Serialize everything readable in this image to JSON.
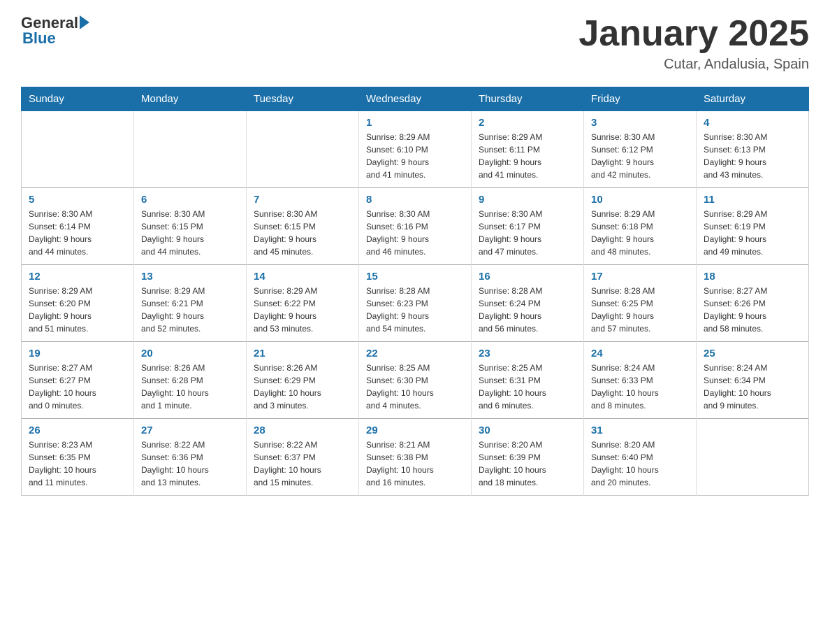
{
  "header": {
    "logo_general": "General",
    "logo_blue": "Blue",
    "title": "January 2025",
    "subtitle": "Cutar, Andalusia, Spain"
  },
  "weekdays": [
    "Sunday",
    "Monday",
    "Tuesday",
    "Wednesday",
    "Thursday",
    "Friday",
    "Saturday"
  ],
  "weeks": [
    [
      {
        "day": "",
        "info": ""
      },
      {
        "day": "",
        "info": ""
      },
      {
        "day": "",
        "info": ""
      },
      {
        "day": "1",
        "info": "Sunrise: 8:29 AM\nSunset: 6:10 PM\nDaylight: 9 hours\nand 41 minutes."
      },
      {
        "day": "2",
        "info": "Sunrise: 8:29 AM\nSunset: 6:11 PM\nDaylight: 9 hours\nand 41 minutes."
      },
      {
        "day": "3",
        "info": "Sunrise: 8:30 AM\nSunset: 6:12 PM\nDaylight: 9 hours\nand 42 minutes."
      },
      {
        "day": "4",
        "info": "Sunrise: 8:30 AM\nSunset: 6:13 PM\nDaylight: 9 hours\nand 43 minutes."
      }
    ],
    [
      {
        "day": "5",
        "info": "Sunrise: 8:30 AM\nSunset: 6:14 PM\nDaylight: 9 hours\nand 44 minutes."
      },
      {
        "day": "6",
        "info": "Sunrise: 8:30 AM\nSunset: 6:15 PM\nDaylight: 9 hours\nand 44 minutes."
      },
      {
        "day": "7",
        "info": "Sunrise: 8:30 AM\nSunset: 6:15 PM\nDaylight: 9 hours\nand 45 minutes."
      },
      {
        "day": "8",
        "info": "Sunrise: 8:30 AM\nSunset: 6:16 PM\nDaylight: 9 hours\nand 46 minutes."
      },
      {
        "day": "9",
        "info": "Sunrise: 8:30 AM\nSunset: 6:17 PM\nDaylight: 9 hours\nand 47 minutes."
      },
      {
        "day": "10",
        "info": "Sunrise: 8:29 AM\nSunset: 6:18 PM\nDaylight: 9 hours\nand 48 minutes."
      },
      {
        "day": "11",
        "info": "Sunrise: 8:29 AM\nSunset: 6:19 PM\nDaylight: 9 hours\nand 49 minutes."
      }
    ],
    [
      {
        "day": "12",
        "info": "Sunrise: 8:29 AM\nSunset: 6:20 PM\nDaylight: 9 hours\nand 51 minutes."
      },
      {
        "day": "13",
        "info": "Sunrise: 8:29 AM\nSunset: 6:21 PM\nDaylight: 9 hours\nand 52 minutes."
      },
      {
        "day": "14",
        "info": "Sunrise: 8:29 AM\nSunset: 6:22 PM\nDaylight: 9 hours\nand 53 minutes."
      },
      {
        "day": "15",
        "info": "Sunrise: 8:28 AM\nSunset: 6:23 PM\nDaylight: 9 hours\nand 54 minutes."
      },
      {
        "day": "16",
        "info": "Sunrise: 8:28 AM\nSunset: 6:24 PM\nDaylight: 9 hours\nand 56 minutes."
      },
      {
        "day": "17",
        "info": "Sunrise: 8:28 AM\nSunset: 6:25 PM\nDaylight: 9 hours\nand 57 minutes."
      },
      {
        "day": "18",
        "info": "Sunrise: 8:27 AM\nSunset: 6:26 PM\nDaylight: 9 hours\nand 58 minutes."
      }
    ],
    [
      {
        "day": "19",
        "info": "Sunrise: 8:27 AM\nSunset: 6:27 PM\nDaylight: 10 hours\nand 0 minutes."
      },
      {
        "day": "20",
        "info": "Sunrise: 8:26 AM\nSunset: 6:28 PM\nDaylight: 10 hours\nand 1 minute."
      },
      {
        "day": "21",
        "info": "Sunrise: 8:26 AM\nSunset: 6:29 PM\nDaylight: 10 hours\nand 3 minutes."
      },
      {
        "day": "22",
        "info": "Sunrise: 8:25 AM\nSunset: 6:30 PM\nDaylight: 10 hours\nand 4 minutes."
      },
      {
        "day": "23",
        "info": "Sunrise: 8:25 AM\nSunset: 6:31 PM\nDaylight: 10 hours\nand 6 minutes."
      },
      {
        "day": "24",
        "info": "Sunrise: 8:24 AM\nSunset: 6:33 PM\nDaylight: 10 hours\nand 8 minutes."
      },
      {
        "day": "25",
        "info": "Sunrise: 8:24 AM\nSunset: 6:34 PM\nDaylight: 10 hours\nand 9 minutes."
      }
    ],
    [
      {
        "day": "26",
        "info": "Sunrise: 8:23 AM\nSunset: 6:35 PM\nDaylight: 10 hours\nand 11 minutes."
      },
      {
        "day": "27",
        "info": "Sunrise: 8:22 AM\nSunset: 6:36 PM\nDaylight: 10 hours\nand 13 minutes."
      },
      {
        "day": "28",
        "info": "Sunrise: 8:22 AM\nSunset: 6:37 PM\nDaylight: 10 hours\nand 15 minutes."
      },
      {
        "day": "29",
        "info": "Sunrise: 8:21 AM\nSunset: 6:38 PM\nDaylight: 10 hours\nand 16 minutes."
      },
      {
        "day": "30",
        "info": "Sunrise: 8:20 AM\nSunset: 6:39 PM\nDaylight: 10 hours\nand 18 minutes."
      },
      {
        "day": "31",
        "info": "Sunrise: 8:20 AM\nSunset: 6:40 PM\nDaylight: 10 hours\nand 20 minutes."
      },
      {
        "day": "",
        "info": ""
      }
    ]
  ]
}
